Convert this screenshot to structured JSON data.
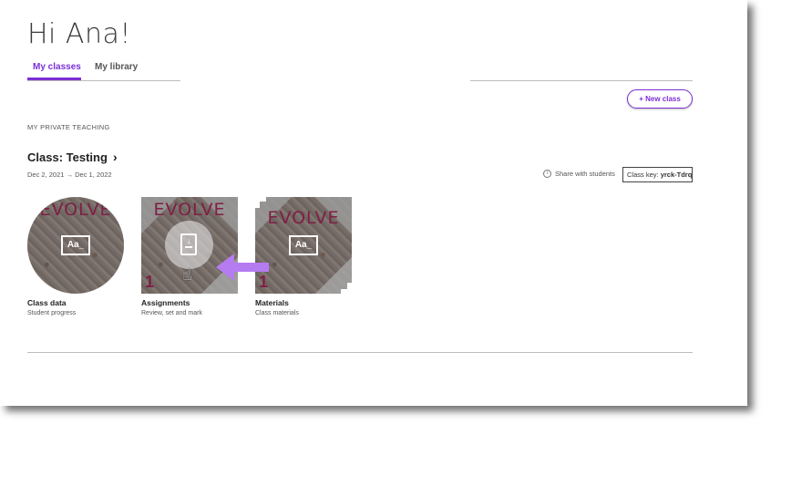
{
  "header": {
    "greeting": "Hi Ana!"
  },
  "tabs": [
    {
      "label": "My classes",
      "active": true
    },
    {
      "label": "My library",
      "active": false
    }
  ],
  "actions": {
    "new_class_label": "+ New class"
  },
  "section": {
    "label": "MY PRIVATE TEACHING"
  },
  "class": {
    "title": "Class: Testing",
    "chevron": "›",
    "start_date": "Dec 2, 2021",
    "arrow": "→",
    "end_date": "Dec 1, 2022",
    "share_label": "Share with students",
    "class_key_label": "Class key:",
    "class_key_value": "yrck-Tdrq"
  },
  "cards": [
    {
      "title": "Class data",
      "subtitle": "Student progress",
      "icon": "aa-text-icon",
      "brand": "EVOLVE"
    },
    {
      "title": "Assignments",
      "subtitle": "Review, set and mark",
      "icon": "document-download-icon",
      "brand": "EVOLVE",
      "level": "1"
    },
    {
      "title": "Materials",
      "subtitle": "Class materials",
      "icon": "aa-text-icon",
      "brand": "EVOLVE",
      "level": "1"
    }
  ],
  "colors": {
    "accent": "#7b2fd6",
    "arrow": "#b57cf2",
    "brand_text": "#7e1f45"
  },
  "icons": {
    "info": "i",
    "aa": "Aa_",
    "hand": "☝"
  }
}
